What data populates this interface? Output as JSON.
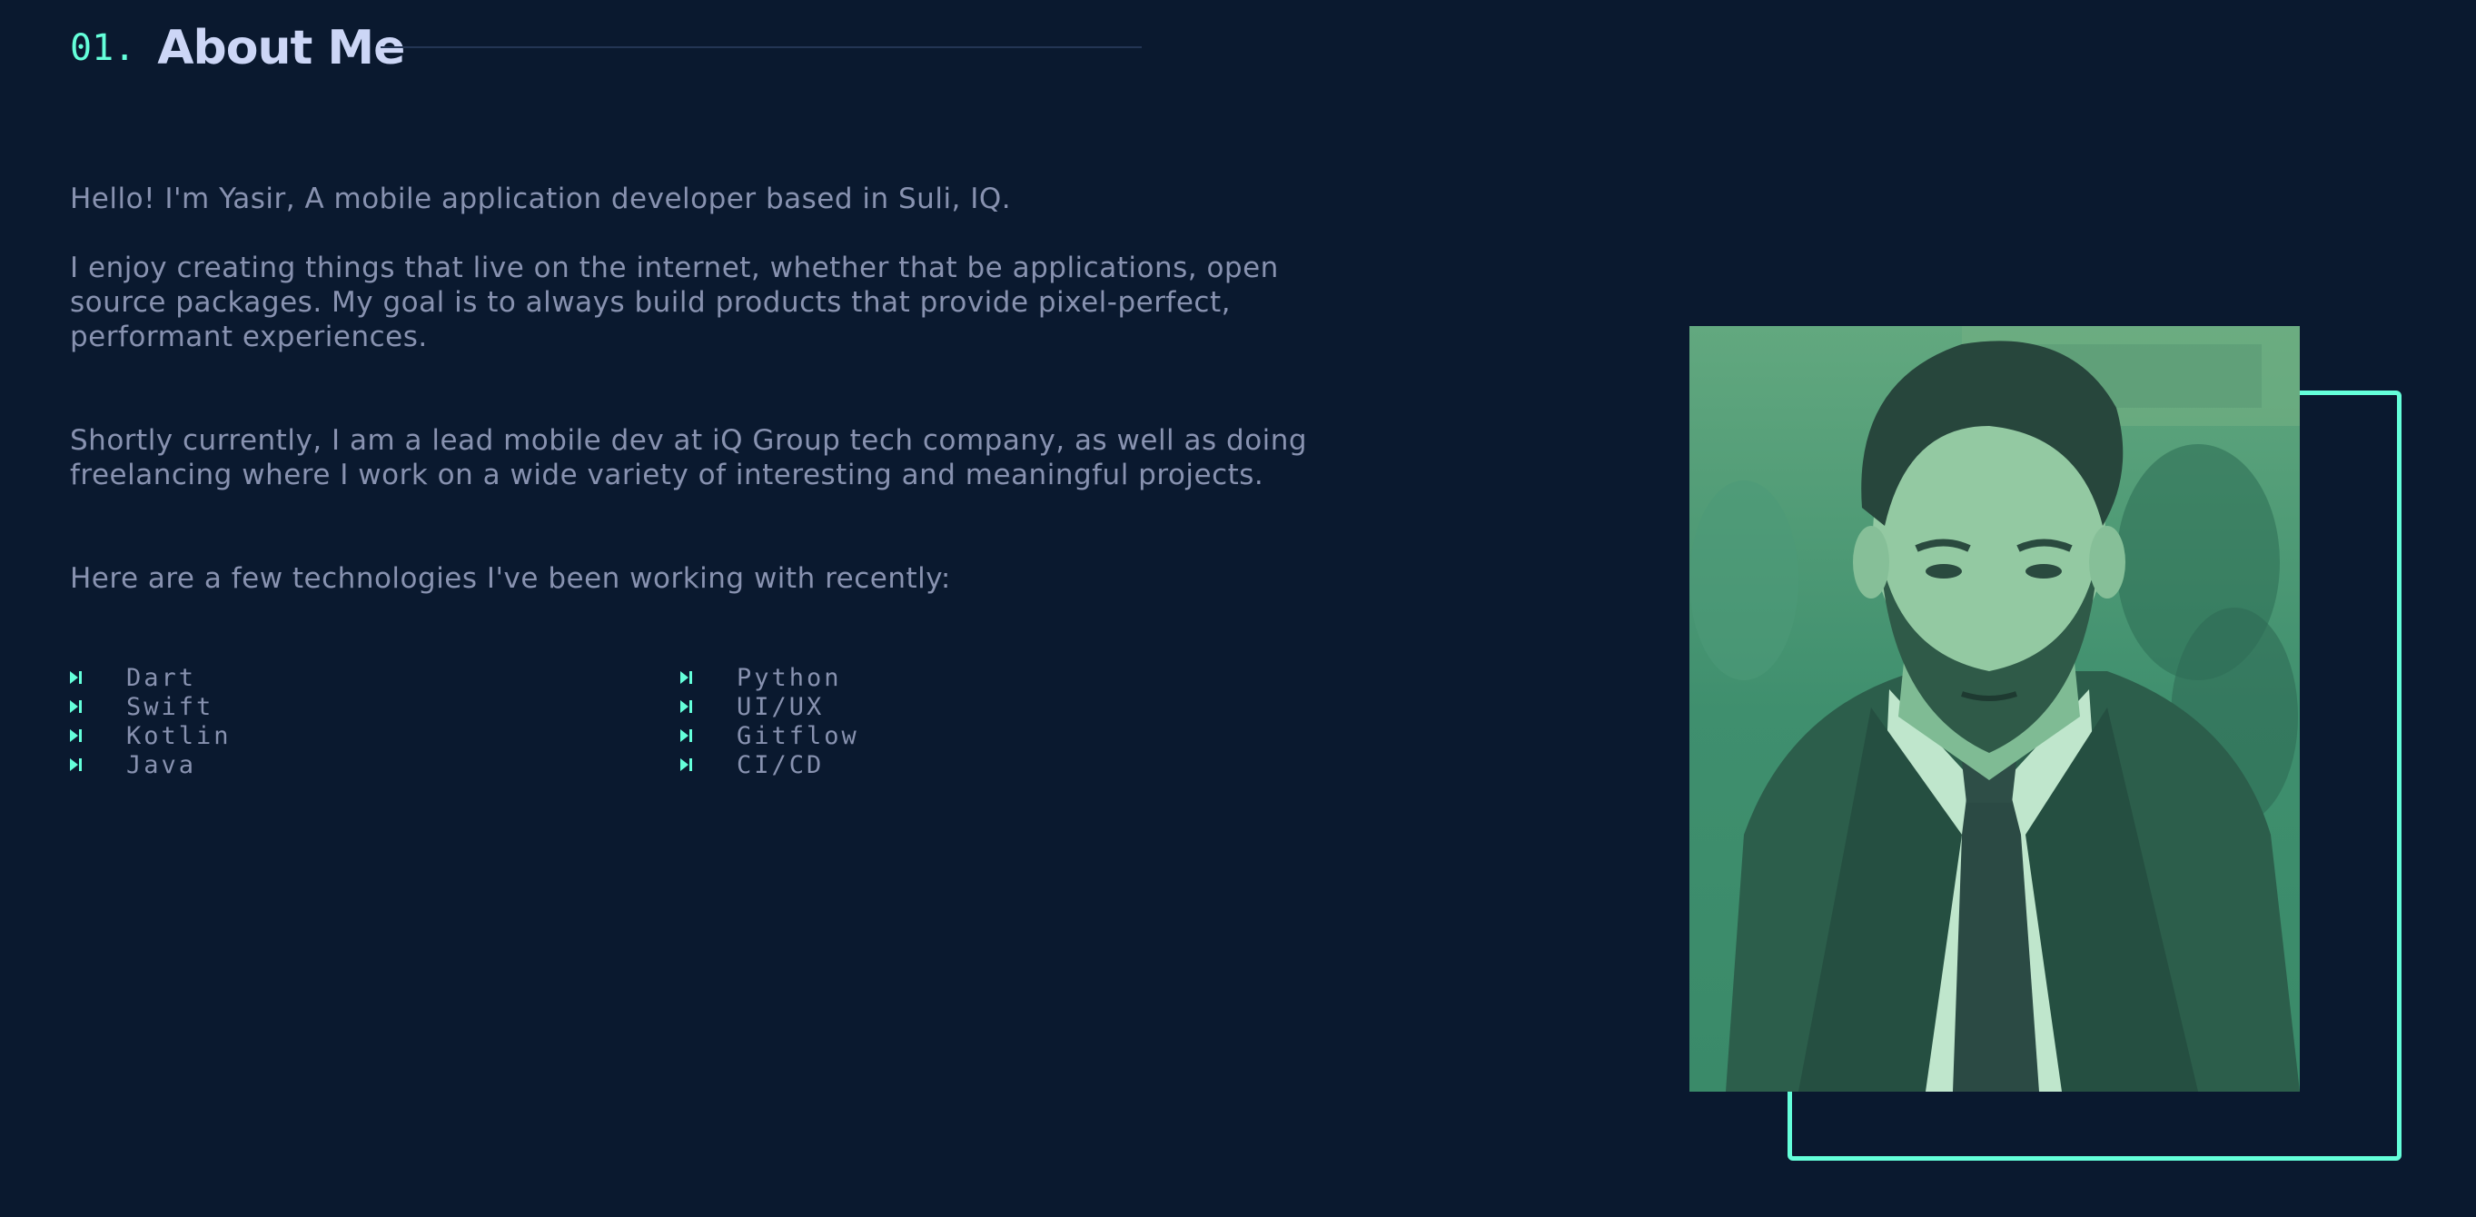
{
  "section": {
    "number": "01.",
    "title": "About Me"
  },
  "about": {
    "p1": "Hello! I'm Yasir, A mobile application developer based in Suli, IQ.",
    "p2": "I enjoy creating things that live on the internet, whether that be applications, open source packages. My goal is to always build products that provide pixel-perfect, performant experiences.",
    "p3": "Shortly currently, I am a lead mobile dev at iQ Group tech company, as well as doing freelancing where I work on a wide variety of interesting and meaningful projects.",
    "p4": "Here are a few technologies I've been working with recently:"
  },
  "technologies": [
    "Dart",
    "Swift",
    "Kotlin",
    "Java",
    "Python",
    "UI/UX",
    "Gitflow",
    "CI/CD"
  ],
  "icons": {
    "list_marker": "play-next-icon"
  },
  "colors": {
    "background": "#0a192f",
    "accent": "#64ffda",
    "heading": "#ccd6f6",
    "text": "#8892b0",
    "line": "#233554",
    "photo_tint": "#3f9b79"
  }
}
